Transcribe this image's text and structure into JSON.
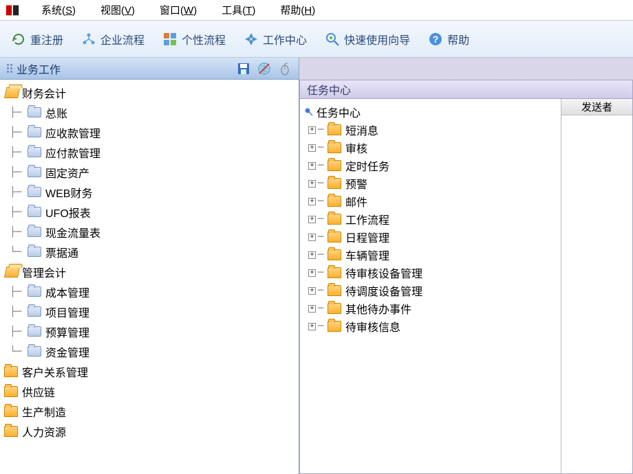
{
  "menubar": {
    "items": [
      {
        "label": "系统",
        "key": "S"
      },
      {
        "label": "视图",
        "key": "V"
      },
      {
        "label": "窗口",
        "key": "W"
      },
      {
        "label": "工具",
        "key": "T"
      },
      {
        "label": "帮助",
        "key": "H"
      }
    ]
  },
  "toolbar": {
    "items": [
      {
        "label": "重注册",
        "icon": "refresh"
      },
      {
        "label": "企业流程",
        "icon": "org"
      },
      {
        "label": "个性流程",
        "icon": "custom"
      },
      {
        "label": "工作中心",
        "icon": "compass"
      },
      {
        "label": "快速使用向导",
        "icon": "wizard"
      },
      {
        "label": "帮助",
        "icon": "help"
      }
    ]
  },
  "leftPanel": {
    "title": "业务工作",
    "tree": [
      {
        "label": "财务会计",
        "type": "open",
        "indent": 0,
        "children": [
          {
            "label": "总账"
          },
          {
            "label": "应收款管理"
          },
          {
            "label": "应付款管理"
          },
          {
            "label": "固定资产"
          },
          {
            "label": "WEB财务"
          },
          {
            "label": "UFO报表"
          },
          {
            "label": "现金流量表"
          },
          {
            "label": "票据通"
          }
        ]
      },
      {
        "label": "管理会计",
        "type": "open",
        "indent": 0,
        "children": [
          {
            "label": "成本管理"
          },
          {
            "label": "项目管理"
          },
          {
            "label": "预算管理"
          },
          {
            "label": "资金管理"
          }
        ]
      },
      {
        "label": "客户关系管理",
        "type": "closed",
        "indent": 0
      },
      {
        "label": "供应链",
        "type": "closed",
        "indent": 0
      },
      {
        "label": "生产制造",
        "type": "closed",
        "indent": 0
      },
      {
        "label": "人力资源",
        "type": "closed",
        "indent": 0
      }
    ]
  },
  "rightPanel": {
    "title": "任务中心",
    "rootLabel": "任务中心",
    "senderHeader": "发送者",
    "items": [
      {
        "label": "短消息"
      },
      {
        "label": "审核"
      },
      {
        "label": "定时任务"
      },
      {
        "label": "预警"
      },
      {
        "label": "邮件"
      },
      {
        "label": "工作流程"
      },
      {
        "label": "日程管理"
      },
      {
        "label": "车辆管理"
      },
      {
        "label": "待审核设备管理"
      },
      {
        "label": "待调度设备管理"
      },
      {
        "label": "其他待办事件"
      },
      {
        "label": "待审核信息"
      }
    ]
  }
}
